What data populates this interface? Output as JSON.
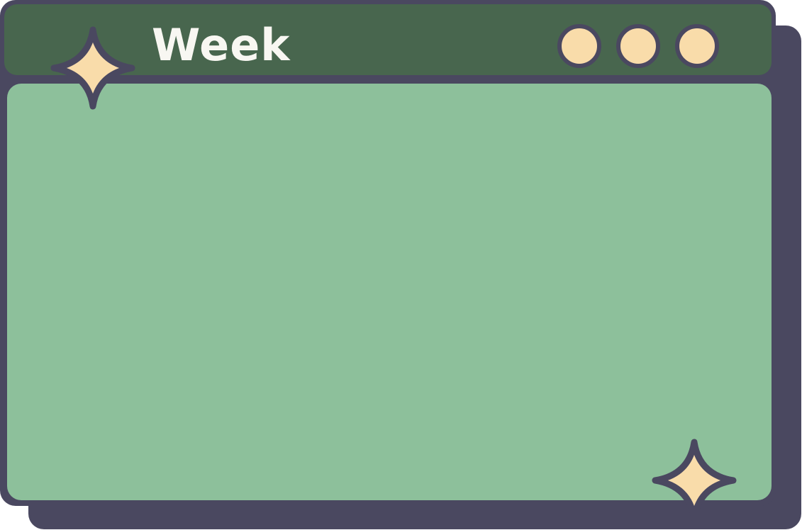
{
  "window": {
    "title": "Week",
    "control_dots": [
      "dot-icon",
      "dot-icon",
      "dot-icon"
    ]
  },
  "decorations": {
    "icons": [
      "sparkle-icon",
      "sparkle-icon"
    ]
  },
  "colors": {
    "outline": "#4a4860",
    "titlebar": "#48664e",
    "content": "#8dc09b",
    "accent": "#f9dcaa",
    "title_text": "#f8f7f2"
  }
}
